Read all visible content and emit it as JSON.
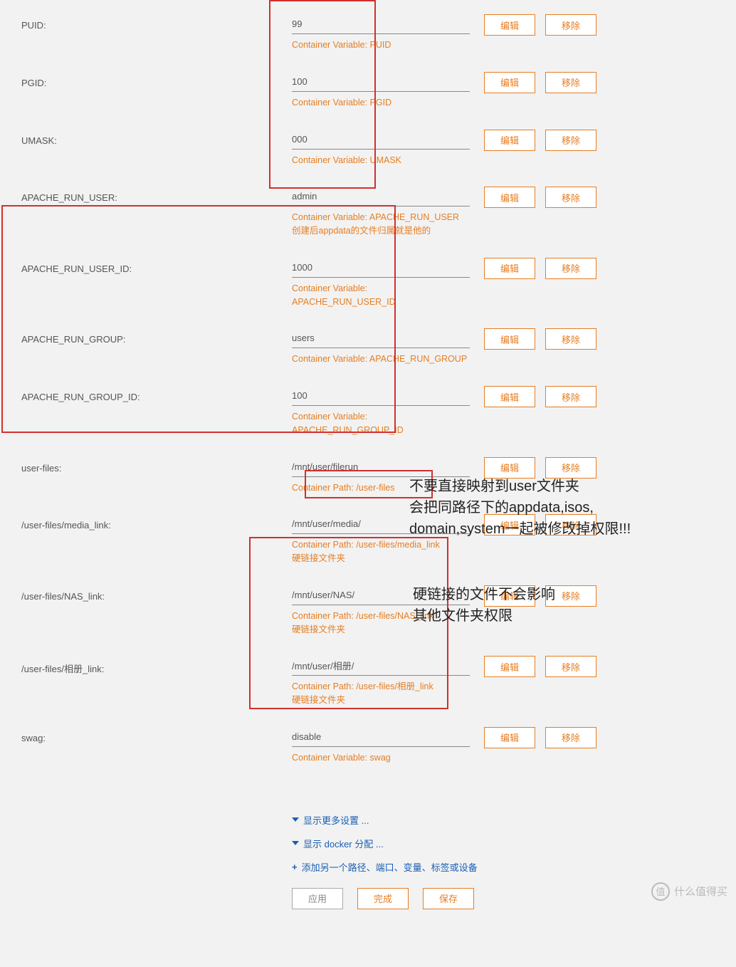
{
  "buttons": {
    "edit": "编辑",
    "remove": "移除",
    "apply": "应用",
    "done": "完成",
    "save": "保存"
  },
  "links": {
    "show_more": "显示更多设置 ...",
    "show_docker": "显示 docker 分配 ...",
    "add_another": "添加另一个路径、端口、变量、标签或设备"
  },
  "rows": [
    {
      "label": "PUID:",
      "value": "99",
      "helper": "Container Variable: PUID"
    },
    {
      "label": "PGID:",
      "value": "100",
      "helper": "Container Variable: PGID"
    },
    {
      "label": "UMASK:",
      "value": "000",
      "helper": "Container Variable: UMASK"
    },
    {
      "label": "APACHE_RUN_USER:",
      "value": "admin",
      "helper": "Container Variable: APACHE_RUN_USER\n创建后appdata的文件归属就是他的"
    },
    {
      "label": "APACHE_RUN_USER_ID:",
      "value": "1000",
      "helper": "Container Variable: APACHE_RUN_USER_ID"
    },
    {
      "label": "APACHE_RUN_GROUP:",
      "value": "users",
      "helper": "Container Variable: APACHE_RUN_GROUP"
    },
    {
      "label": "APACHE_RUN_GROUP_ID:",
      "value": "100",
      "helper": "Container Variable: APACHE_RUN_GROUP_ID"
    },
    {
      "label": "user-files:",
      "value": "/mnt/user/filerun",
      "helper": "Container Path: /user-files"
    },
    {
      "label": "/user-files/media_link:",
      "value": "/mnt/user/media/",
      "helper": "Container Path: /user-files/media_link\n硬链接文件夹"
    },
    {
      "label": "/user-files/NAS_link:",
      "value": "/mnt/user/NAS/",
      "helper": "Container Path: /user-files/NAS_link\n硬链接文件夹"
    },
    {
      "label": "/user-files/相册_link:",
      "value": "/mnt/user/相册/",
      "helper": "Container Path: /user-files/相册_link\n硬链接文件夹"
    },
    {
      "label": "swag:",
      "value": "disable",
      "helper": "Container Variable: swag"
    }
  ],
  "annotations": {
    "a1": "不要直接映射到user文件夹\n会把同路径下的appdata,isos,\ndomain,system一起被修改掉权限!!!",
    "a2": "硬链接的文件不会影响\n其他文件夹权限"
  },
  "watermark": "什么值得买",
  "watermark_badge": "值"
}
